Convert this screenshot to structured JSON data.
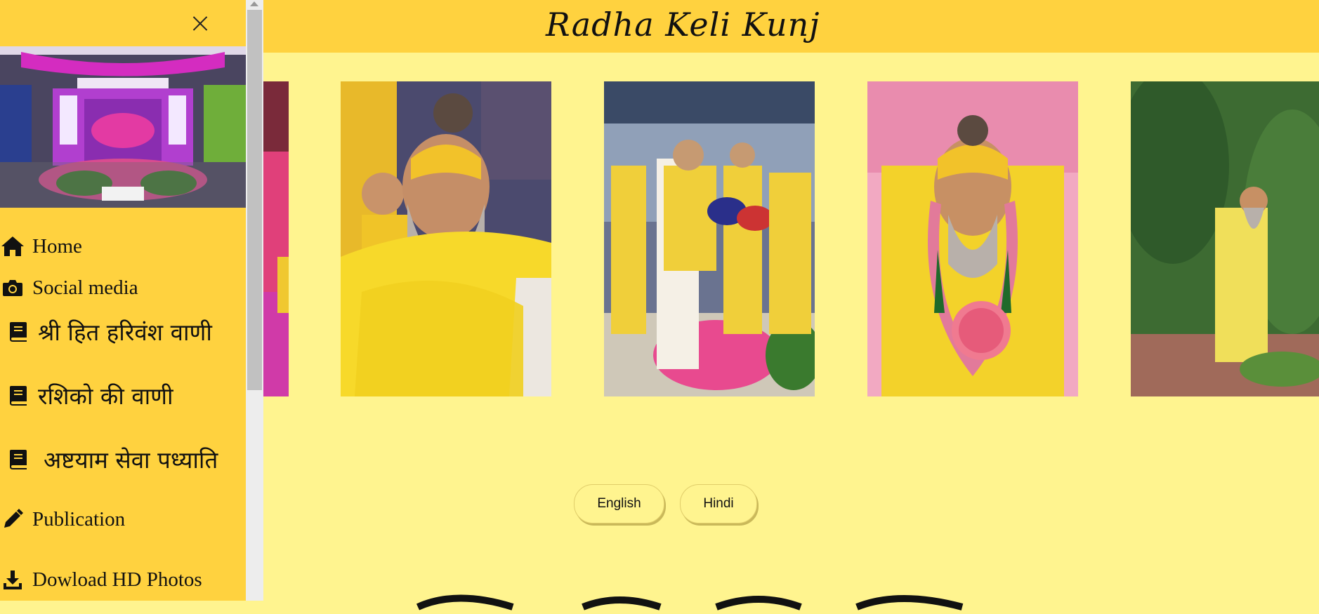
{
  "sidebar": {
    "close_icon": "close-icon",
    "photo_alt": "temple shrine decorated with pink flowers and chandeliers",
    "items": [
      {
        "label": "Home",
        "icon": "home-icon",
        "lang": "en"
      },
      {
        "label": "Social media",
        "icon": "camera-icon",
        "lang": "en"
      },
      {
        "label": "श्री हित हरिवंश वाणी",
        "icon": "book-icon",
        "lang": "hi"
      },
      {
        "label": "रशिको की वाणी",
        "icon": "book-icon",
        "lang": "hi"
      },
      {
        "label": "अष्टयाम सेवा पध्याति",
        "icon": "book-icon",
        "lang": "hi"
      },
      {
        "label": "Publication",
        "icon": "pencil-icon",
        "lang": "en"
      },
      {
        "label": "Dowload HD Photos",
        "icon": "download-icon",
        "lang": "en"
      }
    ]
  },
  "header": {
    "title": "Radha Keli Kunj"
  },
  "gallery": {
    "photos": [
      {
        "alt": "partial photo with pink flowers"
      },
      {
        "alt": "saint with tilak in yellow robe"
      },
      {
        "alt": "saint scattering rose petals"
      },
      {
        "alt": "saint seated with garland"
      },
      {
        "alt": "saint standing in garden with folded hands"
      }
    ]
  },
  "language": {
    "english": "English",
    "hindi": "Hindi"
  },
  "colors": {
    "sidebar": "#ffd23f",
    "header": "#ffd23f",
    "background": "#fff48f"
  }
}
